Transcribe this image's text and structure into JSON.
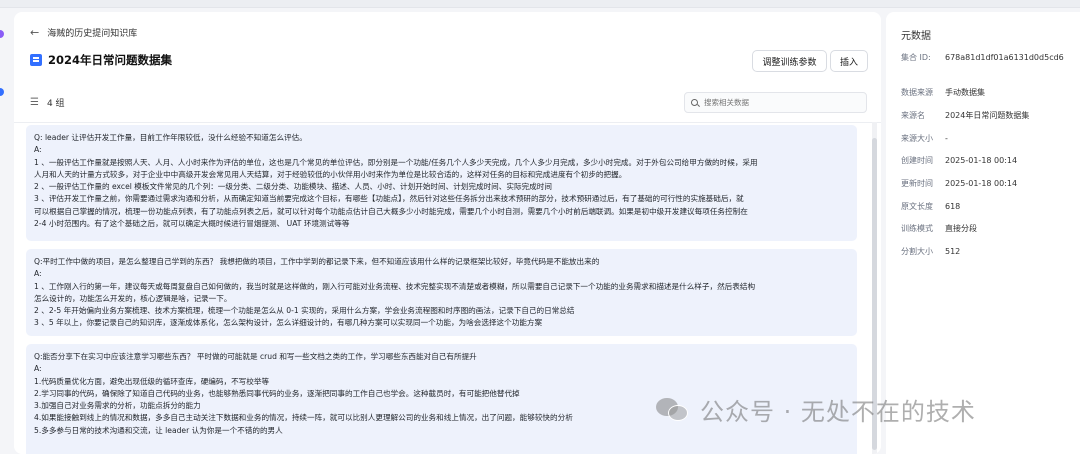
{
  "breadcrumb": {
    "back_label": "海贼的历史提问知识库"
  },
  "collection": {
    "title": "2024年日常问题数据集"
  },
  "toolbar": {
    "train_params_label": "调整训练参数",
    "insert_label": "插入"
  },
  "list": {
    "count_label": "4 组"
  },
  "search": {
    "placeholder": "搜索相关数据"
  },
  "cards": [
    {
      "lines": [
        "Q: leader 让评估开发工作量，目前工作年限较低，没什么经验不知道怎么评估。",
        "A:",
        "1 、一般评估工作量就是按照人天、人月、人小时来作为评估的单位，这也是几个常见的单位评估，即分别是一个功能/任务几个人多少天完成，几个人多少月完成，多少小时完成。对于外包公司给甲方做的时候，采用",
        "人月和人天的计量方式较多，对于企业中中高级开发会常见用人天结算，对于经验较低的小伙伴用小时来作为单位是比较合适的，这样对任务的目标和完成进度有个初步的把握。",
        "2 、一般评估工作量的 excel 模板文件常见的几个列：一级分类、二级分类、功能模块、描述、人员、小时、计划开始时间、计划完成时间、实际完成时间",
        "3 、评估开发工作量之前，你需要通过需求沟通和分析，从而确定知道当前要完成这个目标，有哪些【功能点】，然后针对这些任务拆分出来技术预研的部分，技术预研通过后，有了基础的可行性的实施基础后，就",
        "可以根据自己掌握的情况，梳理一份功能点列表，有了功能点列表之后，就可以针对每个功能点估计自己大概多少小时能完成，需要几个小时自测，需要几个小时前后端联调。如果是初中级开发建议每项任务控制在",
        "2-4 小时范围内。有了这个基础之后，就可以确定大概时候进行冒烟提测、 UAT 环境测试等等"
      ]
    },
    {
      "lines": [
        "Q:平时工作中做的项目，是怎么整理自己学到的东西？ 我想把做的项目，工作中学到的都记录下来，但不知道应该用什么样的记录框架比较好，毕竟代码是不能放出来的",
        "A:",
        "1 、工作刚入行的第一年，建议每天或每周复盘自己如何做的，我当时就是这样做的，刚入行可能对业务流程、技术完整实现不清楚或者模糊，所以需要自己记录下一个功能的业务需求和描述是什么样子，然后表结构",
        "怎么设计的，功能怎么开发的，核心逻辑是啥，记录一下。",
        "2 、2-5 年开始偏向业务方案梳理、技术方案梳理，梳理一个功能是怎么从 0-1 实现的，采用什么方案，学会业务流程图和时序图的画法，记录下自己的日常总结",
        "3 、5 年以上，你要记录自己的知识库，逐渐成体系化，怎么架构设计，怎么详细设计的，有哪几种方案可以实现同一个功能，为啥会选择这个功能方案"
      ]
    },
    {
      "lines": [
        "Q:能否分享下在实习中应该注意学习哪些东西？ 平时做的可能就是 crud 和写一些文档之类的工作，学习哪些东西能对自己有所提升",
        "A:",
        "1.代码质量优化方面，避免出现低级的循环查库，硬编码，不写校举等",
        "2.学习同事的代码，确保除了知道自己代码的业务，也能够熟悉同事代码的业务，逐渐把同事的工作自己也学会。这种截员时，有可能把他替代掉",
        "3.加强自己对业务需求的分析，功能点拆分的能力",
        "4.如果能接触到线上的情况和数据，多多自己主动关注下数据和业务的情况，持续一阵，就可以比别人更理解公司的业务和线上情况，出了问题，能够较快的分析",
        "5.多多参与日常的技术沟通和交流，让 leader 认为你是一个不错的的男人"
      ]
    }
  ],
  "sidebar": {
    "title": "元数据",
    "items": [
      {
        "key": "集合 ID:",
        "value": "678a81d1df01a6131d0d5cd6"
      },
      {
        "key": "数据来源",
        "value": "手动数据集"
      },
      {
        "key": "来源名",
        "value": "2024年日常问题数据集"
      },
      {
        "key": "来源大小",
        "value": "-"
      },
      {
        "key": "创建时间",
        "value": "2025-01-18 00:14"
      },
      {
        "key": "更新时间",
        "value": "2025-01-18 00:14"
      },
      {
        "key": "原文长度",
        "value": "618"
      },
      {
        "key": "训练模式",
        "value": "直接分段"
      },
      {
        "key": "分割大小",
        "value": "512"
      }
    ]
  },
  "watermark": {
    "text": "公众号 · 无处不在的技术"
  },
  "colors": {
    "accent": "#3370ff",
    "card_bg": "#eef2fc"
  }
}
